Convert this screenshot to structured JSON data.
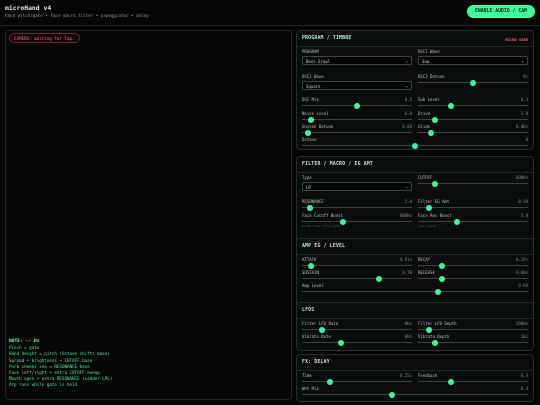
{
  "header": {
    "title": "microHand v4",
    "subtitle": "hand pitch/gate • face macro filter • arpeggiator • delay",
    "enable_button": "ENABLE AUDIO / CAM"
  },
  "camera": {
    "status": "CAMERA: waiting for tap."
  },
  "note": {
    "title": "NOTE: -- Hz",
    "lines": [
      "Pinch = gate",
      "Hand height = pitch (Octave shifts base)",
      "Spread + brightness → CUTOFF base",
      "Pork cheeks see = RESONANCE base",
      "Face left/right + extra CUTOFF sweep",
      "Mouth open + extra RESONANCE (Ladder-LPL)",
      "Arp runs while gate is held"
    ]
  },
  "panels": {
    "program": {
      "title": "PROGRAM / TIMBRE",
      "tag": "MICRO VIBE",
      "program_label": "PROGRAM",
      "program_value": "Bass Growl",
      "osc1_wave_label": "OSC1 Wave",
      "osc1_wave_value": "Saw",
      "osc2_wave_label": "OSC2 Wave",
      "osc2_wave_value": "Square",
      "osc2_detune": {
        "label": "OSC2 Detune",
        "value": "9c",
        "level": 0.5
      },
      "osc_mix": {
        "label": "OSC Mix",
        "value": "0.5",
        "level": 0.5
      },
      "sub_level": {
        "label": "Sub Level",
        "value": "0.3",
        "level": 0.3
      },
      "noise_level": {
        "label": "Noise Level",
        "value": "0.0",
        "level": 0.08
      },
      "drive": {
        "label": "Drive",
        "value": "1.0",
        "level": 0.15
      },
      "unison_detune": {
        "label": "Unison Detune",
        "value": "0.00",
        "level": 0.05
      },
      "glide": {
        "label": "Glide",
        "value": "0.00s",
        "level": 0.12
      },
      "octave": {
        "label": "Octave",
        "value": "0",
        "level": 0.5
      }
    },
    "filter": {
      "title": "FILTER / MACRO / EG AMT",
      "type_label": "Type",
      "type_value": "LP",
      "cutoff": {
        "label": "CUTOFF",
        "value": "800Hz",
        "level": 0.15
      },
      "resonance": {
        "label": "RESONANCE",
        "value": "5.0",
        "level": 0.07
      },
      "filter_eg_amt": {
        "label": "Filter EG Amt",
        "value": "0.50",
        "level": 0.1
      },
      "face_cutoff_boost": {
        "label": "Face Cutoff Boost",
        "value": "800Hz",
        "level": 0.37,
        "hint": "mouth face left/right"
      },
      "face_res_boost": {
        "label": "Face Res Boost",
        "value": "5.0",
        "level": 0.35,
        "hint": "open mouth"
      }
    },
    "amp": {
      "title": "AMP EG / LEVEL",
      "attack": {
        "label": "ATTACK",
        "value": "0.01s",
        "level": 0.08
      },
      "decay": {
        "label": "DECAY",
        "value": "0.20s",
        "level": 0.22
      },
      "sustain": {
        "label": "SUSTAIN",
        "value": "0.70",
        "level": 0.7
      },
      "release": {
        "label": "RELEASE",
        "value": "0.60s",
        "level": 0.22
      },
      "amp_level": {
        "label": "Amp Level",
        "value": "0.60",
        "level": 0.6
      }
    },
    "lfos": {
      "title": "LFOS",
      "filter_lfo_rate": {
        "label": "Filter LFO Rate",
        "value": "0Hz",
        "level": 0.18
      },
      "filter_lfo_depth": {
        "label": "Filter LFO Depth",
        "value": "500Hz",
        "level": 0.1
      },
      "vibrato_rate": {
        "label": "Vibrato Rate",
        "value": "0Hz",
        "level": 0.35
      },
      "vibrato_depth": {
        "label": "Vibrato Depth",
        "value": "10c",
        "level": 0.15
      }
    },
    "delay": {
      "title": "FX: DELAY",
      "time": {
        "label": "Time",
        "value": "0.25s",
        "level": 0.25
      },
      "feedback": {
        "label": "Feedback",
        "value": "0.3",
        "level": 0.3
      },
      "wet_mix": {
        "label": "Wet Mix",
        "value": "0.4",
        "level": 0.4
      }
    }
  },
  "colors": {
    "accent": "#3dff9b",
    "camera_status": "#ff6b7e",
    "tag": "#ff5b78",
    "note_text": "#4df09a"
  }
}
